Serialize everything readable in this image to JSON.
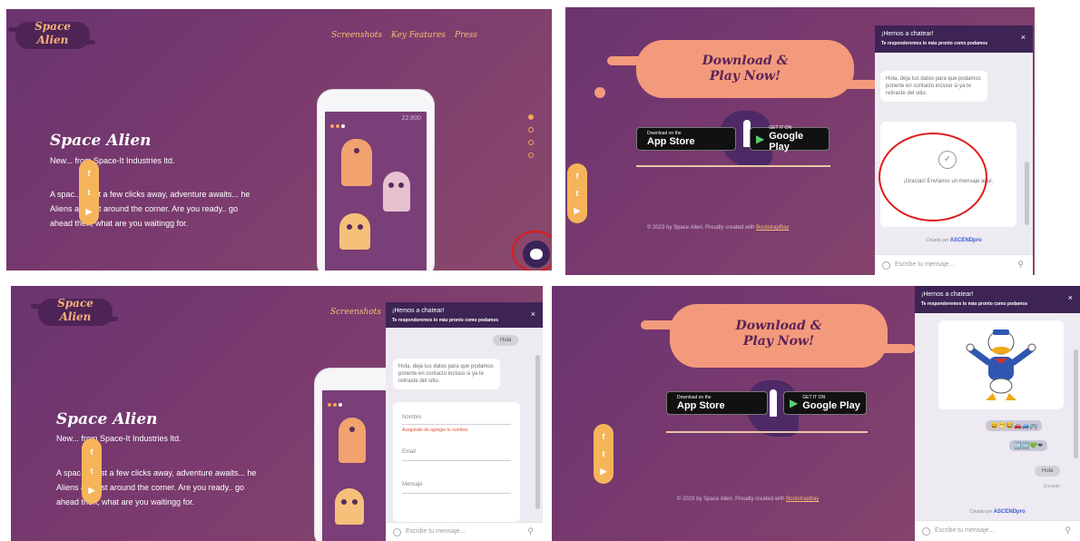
{
  "brand": {
    "line1": "Space",
    "line2": "Alien"
  },
  "nav": [
    "Screenshots",
    "Key Features",
    "Press"
  ],
  "hero": {
    "title": "Space Alien",
    "subtitle": "New... from Space-It Industries ltd.",
    "body": "A spac... [Just a few clicks away, adventure awaits... he Aliens are just around the corner. Are you ready.. go ahead then, what are you waitingg for."
  },
  "social": [
    "f",
    "t",
    "▶"
  ],
  "phone": {
    "score": "22,800"
  },
  "download": {
    "line1": "Download &",
    "line2": "Play Now!",
    "app_store": {
      "small": "Download on the",
      "big": "App Store"
    },
    "google_play": {
      "small": "GET IT ON",
      "big": "Google Play"
    },
    "footer_text": "© 2023 by Space Alien. Proudly created with",
    "footer_link": "BootstrapBay"
  },
  "chat": {
    "title": "¡Hemos a chatear!",
    "subtitle": "Te responderemos lo más pronto como podamos",
    "close": "×",
    "greeting_reply": "Hola",
    "bot_message": "Hola, deja tus datos para que podamos ponerte en contacto incluso si ya te retiraste del sitio.",
    "success_message": "¡Gracias! Envíanos un mensaje aquí.",
    "form": {
      "name_label": "Nombre",
      "name_error": "Asegúrate de agregar tu nombre.",
      "email_label": "Email",
      "message_label": "Mensaje"
    },
    "powered_prefix": "Creado por",
    "powered_brand": "ASCENDpro",
    "input_placeholder": "Escribe tu mensaje...",
    "emoji_row1": "😀😁😂🚗🚙🚌",
    "emoji_row2": "🆗🆒💚❤",
    "last_reply": "Hola",
    "status": "Enviado"
  },
  "colors": {
    "bg": "#6a3470",
    "accent": "#f5a65a",
    "chat_header": "#3d2455",
    "highlight_ring": "#e01a1a"
  }
}
